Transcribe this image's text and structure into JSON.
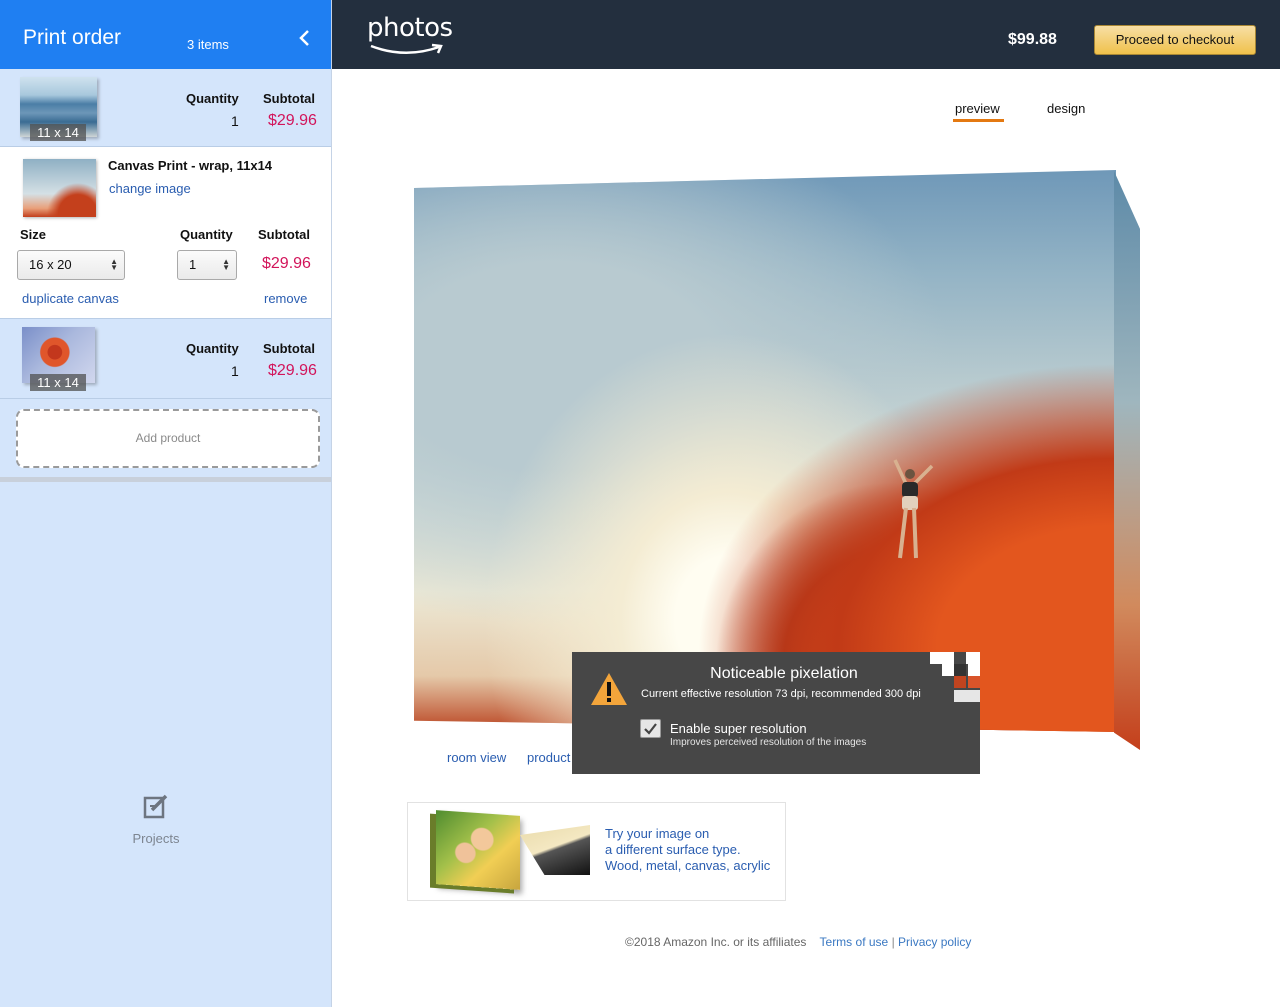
{
  "sidebar": {
    "title": "Print order",
    "item_count": "3 items",
    "items": [
      {
        "size_tag": "11 x 14",
        "quantity_label": "Quantity",
        "quantity": "1",
        "subtotal_label": "Subtotal",
        "subtotal": "$29.96"
      },
      {
        "product_name": "Canvas Print - wrap, 11x14",
        "change_image": "change image",
        "size_label": "Size",
        "size_value": "16 x 20",
        "quantity_label": "Quantity",
        "quantity": "1",
        "subtotal_label": "Subtotal",
        "subtotal": "$29.96",
        "duplicate": "duplicate canvas",
        "remove": "remove"
      },
      {
        "size_tag": "11 x 14",
        "quantity_label": "Quantity",
        "quantity": "1",
        "subtotal_label": "Subtotal",
        "subtotal": "$29.96"
      }
    ],
    "add_product": "Add product",
    "projects_label": "Projects"
  },
  "topbar": {
    "logo": "photos",
    "total": "$99.88",
    "checkout": "Proceed to checkout"
  },
  "tabs": [
    "preview",
    "design"
  ],
  "preview_links": [
    "room view",
    "product"
  ],
  "popup": {
    "title": "Noticeable pixelation",
    "subtitle": "Current effective resolution 73 dpi, recommended 300 dpi",
    "checkbox_label": "Enable super resolution",
    "checkbox_sub": "Improves perceived resolution of the images",
    "checked": true
  },
  "promo": {
    "line1": "Try your image on",
    "line2": "a different surface type.",
    "line3": "Wood, metal, canvas, acrylic"
  },
  "footer": {
    "copyright": "©2018 Amazon Inc. or its affiliates",
    "terms": "Terms of use",
    "separator": "|",
    "privacy": "Privacy policy"
  },
  "colors": {
    "accent_blue": "#1f7ff2",
    "topbar": "#232f3e",
    "price": "#d2145a",
    "link": "#2a5db0",
    "tab_active": "#e47911"
  }
}
